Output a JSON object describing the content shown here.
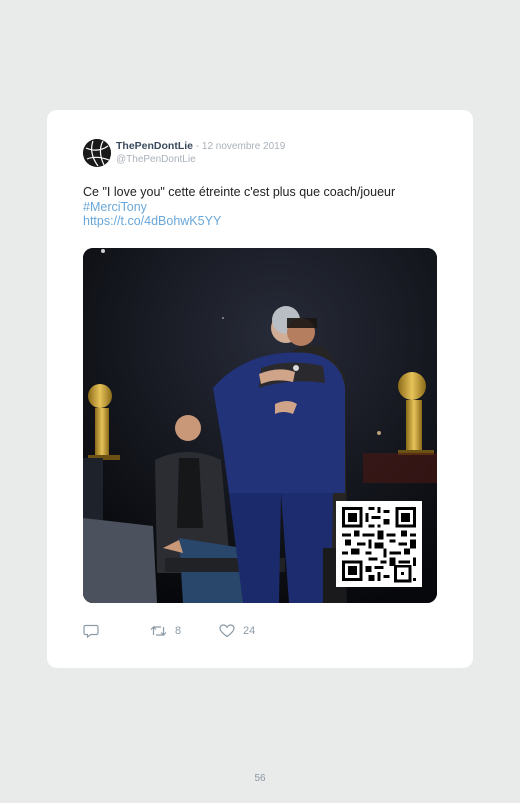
{
  "tweet": {
    "display_name": "ThePenDontLie",
    "separator": " - ",
    "date": "12 novembre 2019",
    "handle": "@ThePenDontLie",
    "text": "Ce \"I love you\" cette étreinte c'est plus que coach/joueur",
    "hashtag": "#MerciTony",
    "url": "https://t.co/4dBohwK5YY",
    "retweet_count": "8",
    "like_count": "24"
  },
  "icons": {
    "avatar": "basketball-icon",
    "reply": "reply-icon",
    "retweet": "retweet-icon",
    "like": "heart-icon",
    "qr": "qr-code"
  },
  "page": {
    "number": "56"
  },
  "colors": {
    "background": "#e9eaea",
    "card": "#ffffff",
    "link": "#6aa7d8",
    "muted": "#a9b1ba"
  }
}
